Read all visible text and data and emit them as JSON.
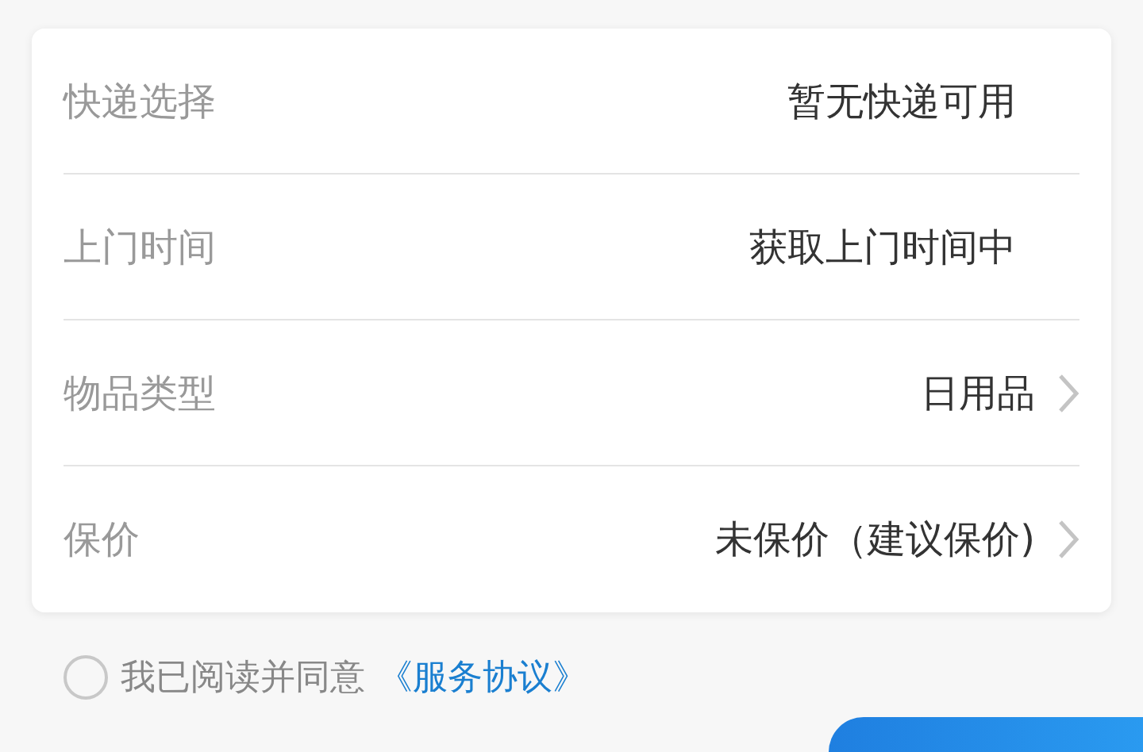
{
  "rows": [
    {
      "label": "快递选择",
      "value": "暂无快递可用",
      "kind": "static"
    },
    {
      "label": "上门时间",
      "value": "获取上门时间中",
      "kind": "static"
    },
    {
      "label": "物品类型",
      "value": "日用品",
      "kind": "link"
    },
    {
      "label": "保价",
      "value": "未保价（建议保价)",
      "kind": "link"
    }
  ],
  "agreement": {
    "checked": false,
    "text": "我已阅读并同意",
    "link": "《服务协议》"
  }
}
